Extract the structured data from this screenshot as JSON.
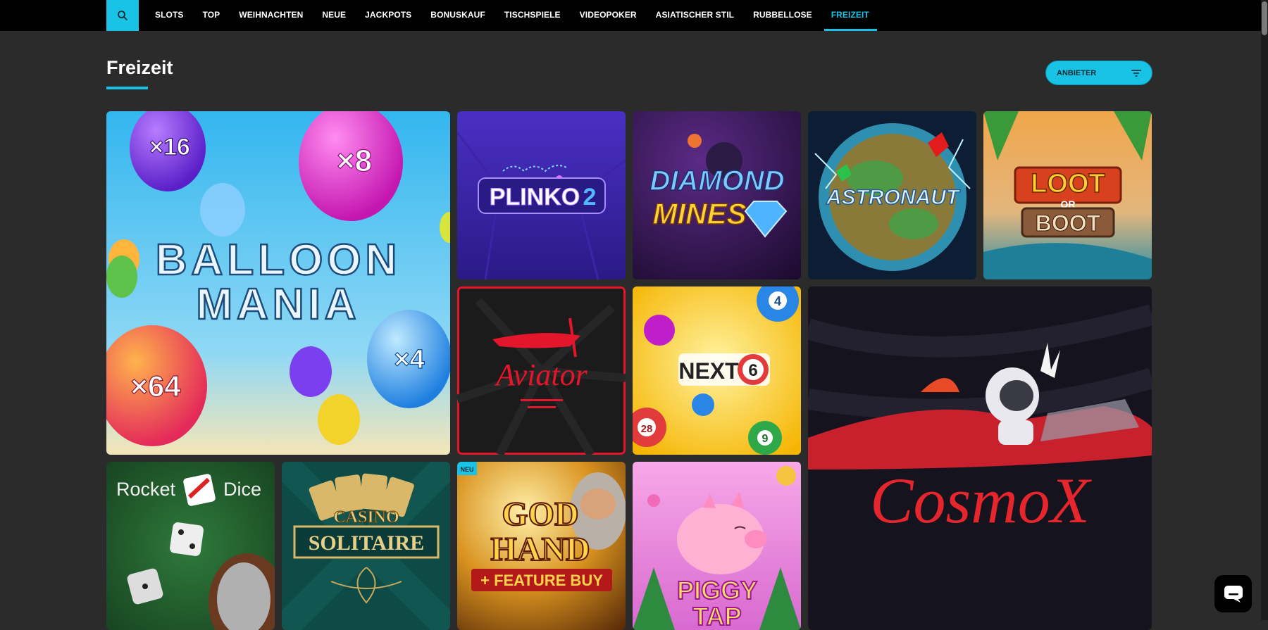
{
  "nav": {
    "items": [
      "SLOTS",
      "TOP",
      "WEIHNACHTEN",
      "NEUE",
      "JACKPOTS",
      "BONUSKAUF",
      "TISCHSPIELE",
      "VIDEOPOKER",
      "ASIATISCHER STIL",
      "RUBBELLOSE",
      "FREIZEIT"
    ],
    "active": "FREIZEIT"
  },
  "page": {
    "title": "Freizeit"
  },
  "filter": {
    "provider_label": "ANBIETER"
  },
  "games": {
    "balloon": {
      "line1": "BALLOON",
      "line2": "MANIA",
      "m16": "×16",
      "m8": "×8",
      "m64": "×64",
      "m4": "×4"
    },
    "plinko": {
      "title": "PLINKO",
      "num": "2"
    },
    "diamond": {
      "line1": "DIAMOND",
      "line2": "MINES"
    },
    "astronaut": {
      "title": "ASTRONAUT"
    },
    "loot": {
      "line1": "LOOT",
      "line2": "OR",
      "line3": "BOOT"
    },
    "aviator": {
      "title": "Aviator"
    },
    "next6": {
      "title": "NEXT",
      "num": "6",
      "ball1": "4",
      "ball2": "28",
      "ball3": "9"
    },
    "cosmox": {
      "title": "CosmoX"
    },
    "rocketdice": {
      "word1": "Rocket",
      "word2": "Dice"
    },
    "solitaire": {
      "line1": "CASINO",
      "line2": "SOLITAIRE"
    },
    "godhand": {
      "badge": "NEU",
      "line1": "GOD",
      "line2": "HAND",
      "line3": "+ FEATURE BUY"
    },
    "piggy": {
      "line1": "PIGGY",
      "line2": "TAP"
    }
  },
  "colors": {
    "accent": "#19c3e6",
    "background": "#2b2b2b",
    "topbar": "#000000"
  },
  "icons": {
    "search": "search-icon",
    "filter": "filter-icon",
    "chat": "chat-icon"
  }
}
